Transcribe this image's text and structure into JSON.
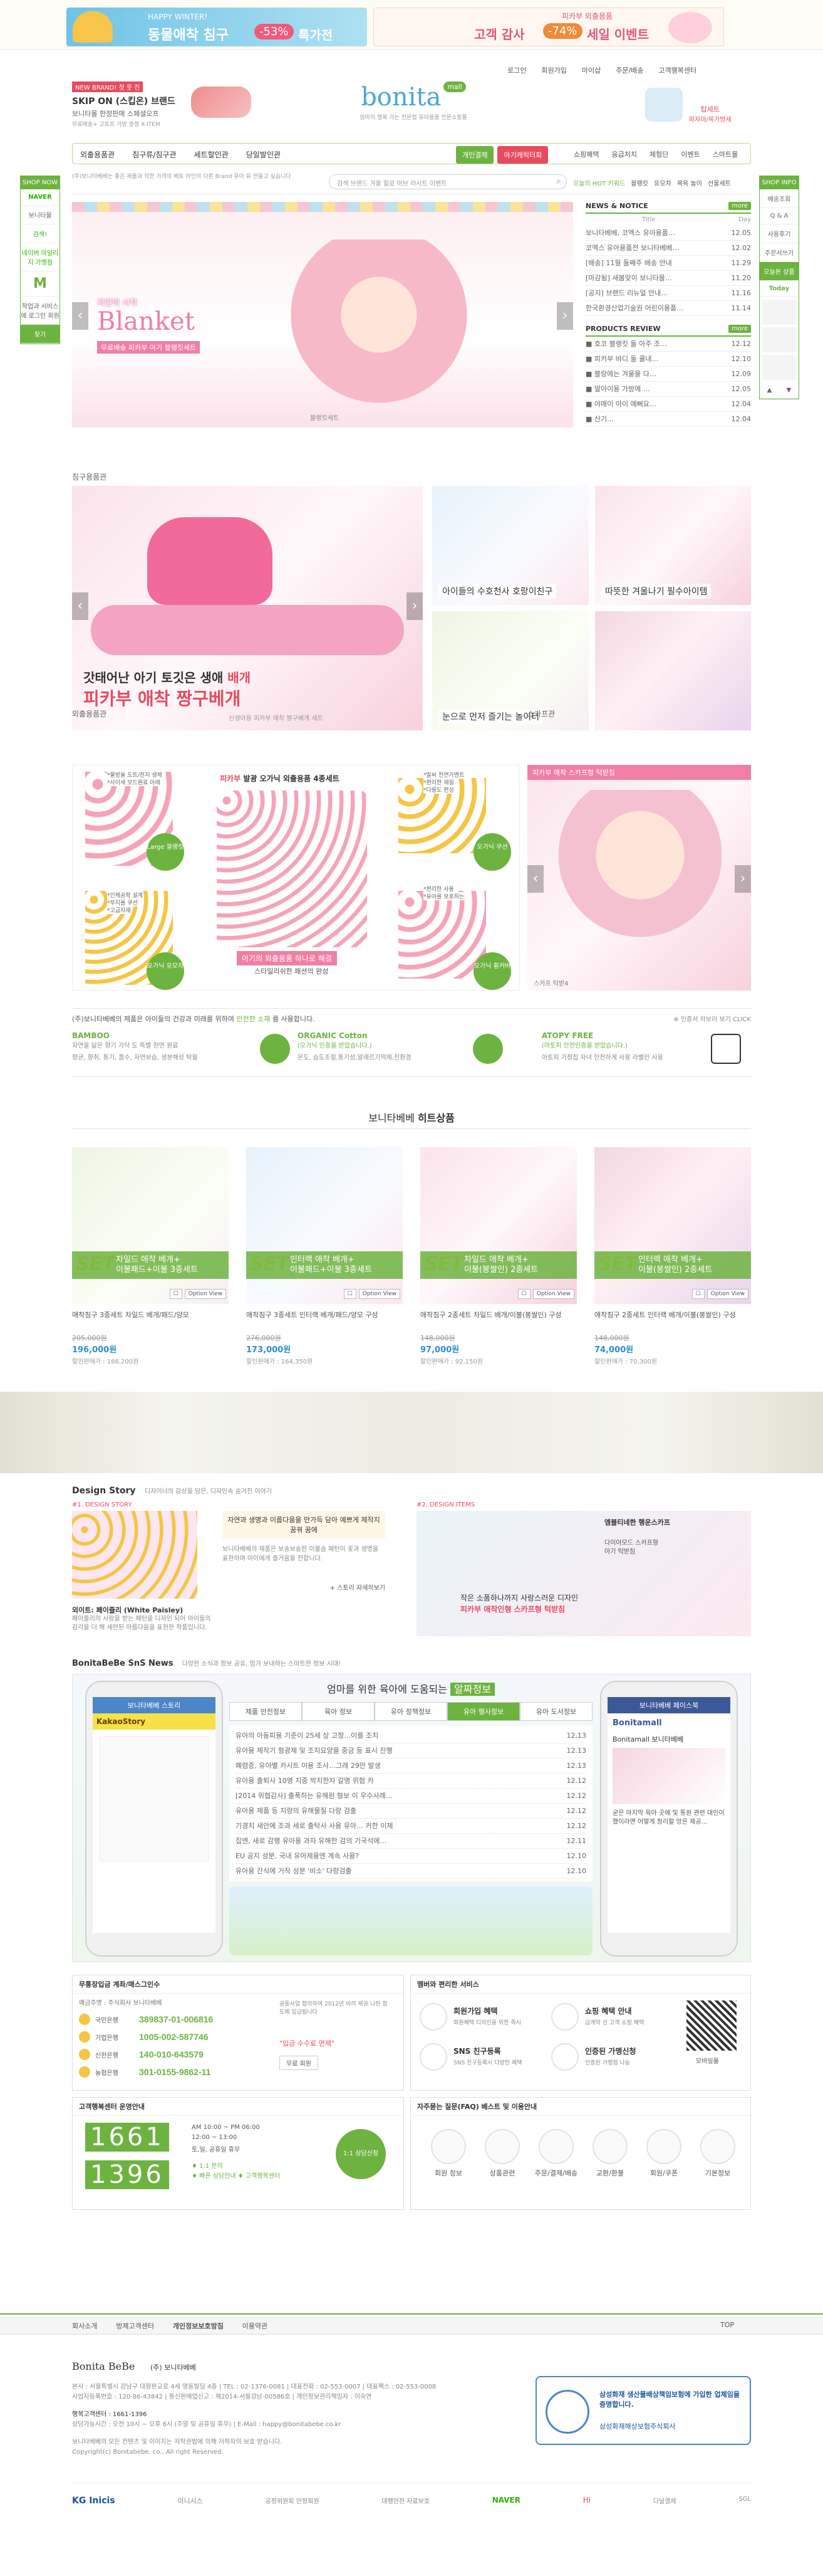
{
  "top_banner": {
    "left_sub": "HAPPY WINTER!",
    "left_title": "동물애착 침구",
    "left_badge": "-53%",
    "left_tail": "특가전",
    "right_sub": "피카부 외출용품",
    "right_title": "고객 감사",
    "right_badge": "-74%",
    "right_tail": "세일 이벤트"
  },
  "util_menu": [
    "로그인",
    "회원가입",
    "마이샵",
    "주문/배송",
    "고객행복센터"
  ],
  "header": {
    "new_brand_tag": "NEW BRAND! 첫 웃 진",
    "promo_title": "SKIP ON (스킵온) 브랜드",
    "promo_sub": "보니타몰 한정판매 스페셜오프",
    "promo_sub2": "무료배송+ 고토트 가방 증정 X-ITEM",
    "logo": "bonita",
    "logo_badge": "mall",
    "logo_tagline": "엄마의 행복 가는 전문점 유아용품 전문쇼핑몰",
    "right_promo1": "탑세트",
    "right_promo2": "파자마/목가방세"
  },
  "gnb": {
    "left": [
      "외출용품관",
      "침구류/침구관",
      "세트할인관",
      "당일발인관"
    ],
    "right_tab1": "개인결제",
    "right_tab2": "아기캐릭터회",
    "right_menu": [
      "쇼핑혜택",
      "응급처치",
      "체험단",
      "이벤트",
      "스마트몰"
    ]
  },
  "side_left": {
    "top_label": "SHOP NOW",
    "naver": "NAVER",
    "naver_sub": "보니타몰",
    "naver_btn": "검색!",
    "naver_desc": "네이버 마일리지 가맹점",
    "m_label": "M",
    "m_desc": "작업과 서비스에 로그인 회원",
    "m_btn": "찾기"
  },
  "notice_bar": {
    "text": "(주)보니타베베는 좋은 제품과 착한 가격의 베토 라인의 다른 Brand 유아 유 만들고 싶습니다",
    "search_placeholder": "검색 브랜드 겨울 할로 어브 라시트 이벤트",
    "hot_label": "오늘의 HOT 키워드",
    "hot_keywords": [
      "블랭킷",
      "유모차",
      "목욕 놀이",
      "선물세트"
    ]
  },
  "hero": {
    "small": "자연의 시작",
    "title": "Blanket",
    "caption": "무료배송 피카부 아기 블랭킷세트",
    "counter": "블랭킷세트"
  },
  "news": {
    "title": "NEWS & NOTICE",
    "more": "more",
    "col_title": "Title",
    "col_day": "Day",
    "items": [
      {
        "t": "보니타베베, 코엑스 유아용품…",
        "d": "12.05"
      },
      {
        "t": "코엑스 유아용품전 보니타베베…",
        "d": "12.02"
      },
      {
        "t": "[배송] 11월 둘째주 배송 안내",
        "d": "11.29"
      },
      {
        "t": "[마감됨] 새봄맞이 보니타몰…",
        "d": "11.20"
      },
      {
        "t": "[공지] 브랜드 리뉴얼 안내…",
        "d": "11.16"
      },
      {
        "t": "한국환경산업기술원 어린이용품…",
        "d": "11.14"
      }
    ],
    "review_title": "PRODUCTS REVIEW",
    "reviews": [
      {
        "t": "■ 호코 블랭킷 돌 아주 조…",
        "d": "12.12"
      },
      {
        "t": "■ 피카부 바디 돌 쿨내…",
        "d": "12.10"
      },
      {
        "t": "■ 블랑에는 겨울을 다…",
        "d": "12.09"
      },
      {
        "t": "■ 딸아이용 가방에 …",
        "d": "12.05"
      },
      {
        "t": "■ 야매이 아이 예뻐요…",
        "d": "12.04"
      },
      {
        "t": "■ 산기…",
        "d": "12.04"
      }
    ]
  },
  "section_sleep": {
    "title": "침구용품관",
    "main_line1": "갓태어난 아기 토깃은 생애",
    "main_line1b": "배개",
    "main_line2": "피카부 애착 짱구베개",
    "main_caption": "신생아용 피카부 애착 짱구베개 세트",
    "thumbs": [
      "아이들의 수호천사 호랑이친구",
      "따뜻한 겨울나기 필수아이템",
      "눈으로 먼저 즐기는 놀이터",
      ""
    ]
  },
  "section_outdoor": {
    "title": "외출용품관",
    "labels": [
      "*물방울 도트/천지 생체",
      "*사이세 모드원료 아래",
      "*인체공학 설계",
      "*무지를 쿠션",
      "*고급자재"
    ],
    "center_head": "피카부",
    "center_head2": "발광 오가닉 외출용품 4종세트",
    "center_sub1": "아기의 외출용품 하나로 해결",
    "center_sub2": "스타일리쉬한 패션의 완성",
    "right_labels": [
      "*말씨 천연가멘트",
      "*편리한 재질",
      "*다용도 편성",
      "*편리한 사용",
      "*유아를 보호하는"
    ],
    "cta_left_top": "Large 블랭킷",
    "cta_left_bot": "오가닉 유모차",
    "cta_right_top": "오가닉 쿠션",
    "cta_right_bot": "오가닉 휠커버",
    "scarf_title": "스카프관",
    "scarf_head": "피카부 애착 스카프형 턱받침",
    "scarf_counter": "스카프 턱받4"
  },
  "eco": {
    "intro": "(주)보니타베베의 제품은 아이들의 건강과 미래를 위하여",
    "intro_accent": "안전한 소재",
    "intro_tail": "를 사용합니다.",
    "cert_label": "※ 인증서 차보러 보기 CLICK",
    "items": [
      {
        "title": "BAMBOO",
        "desc": "자연을 닮은 향기 가닥 도 특별 천연 원료",
        "note": "향균, 향취, 통기, 흡수, 자연보습, 생분해성 탁월"
      },
      {
        "title": "ORGANIC Cotton",
        "desc": "(오가닉 인증을 받았습니다.)",
        "note": "온도, 습도조절,통기성,알레르기억제,친환경"
      },
      {
        "title": "ATOPY FREE",
        "desc": "(아토피 안전인증을 받았습니다.)",
        "note": "아토피 가정집 자녀 안전하게 사용 라벨인 사용"
      }
    ]
  },
  "hits": {
    "title_prefix": "보니타베베",
    "title": "히트상품",
    "products": [
      {
        "banner1": "차일드 애착 베개+",
        "banner2": "이불패드+이불 3종세트",
        "name": "애착침구 3종세트 차일드 베개/패드/양모",
        "old": "205,000원",
        "price": "196,000원",
        "coupon": "할인판매가 : 186,200원"
      },
      {
        "banner1": "인터랙 애착 베개+",
        "banner2": "이불패드+이불 3종세트",
        "name": "애착침구 3종세트 인터랙 베개/패드/양모 구성",
        "old": "276,000원",
        "price": "173,000원",
        "coupon": "할인판매가 : 164,350원"
      },
      {
        "banner1": "차일드 애착 베개+",
        "banner2": "이불(봉쌀인) 2종세트",
        "name": "애착침구 2종세트 차일드 베개/이불(봉쌀인) 구성",
        "old": "148,000원",
        "price": "97,000원",
        "coupon": "할인판매가 : 92,150원"
      },
      {
        "banner1": "인터랙 애착 베개+",
        "banner2": "이불(봉쌀인) 2종세트",
        "name": "애착침구 2종세트 인터랙 베개/이불(봉쌀인) 구성",
        "old": "148,000원",
        "price": "74,000원",
        "coupon": "할인판매가 : 70,300원"
      }
    ],
    "buy_btn": "Option View",
    "set_label": "SET"
  },
  "design_story": {
    "title": "Design Story",
    "sub": "디자이너의 감성을 담은, 디자인속 숨겨진 이야기",
    "left_label": "#1. DESIGN STORY",
    "left_desc_title": "자연과 생명과 이름다움을 만가득 담아 예쁘게 제작지 꿈꿔 꿈에",
    "left_caption": "보니타베베의 제품은 보송보송한 이불솜 패턴이 꽃과 생명을 표현하며 아이에게 즐거움을 전합니다.",
    "paisley_title": "외이트: 페이즐리 (White Paisley)",
    "paisley_desc": "페이즐리의 사랑을 받는 패턴을 디자인 되어 아이들의 감각을 더 해 세련된 아름다움을 표현한 작품입니다.",
    "story_link": "+ 스토리 자세히보기",
    "right_label": "#2. DESIGN ITEMS",
    "right_head": "엠블티네한 행운스카프",
    "right_item1": "다이아모드 스카프형",
    "right_item2": "아기 턱받침",
    "right_caption": "작은 소품하나까지 사랑스러운 디자인",
    "right_caption2": "피카부 애착인형 스카프형 턱받침"
  },
  "sns": {
    "title": "BonitaBeBe SnS News",
    "sub": "다양한 소식과 정보 공유, 엄가 보내하는 스마트한 정보 시대!",
    "left_phone_title": "보니타베베 스토리",
    "left_phone_head": "KakaoStory",
    "right_phone_title": "보니타베베 페이스북",
    "center_heading": "엄마를 위한 육아에 도움되는",
    "center_heading_accent": "알짜정보",
    "tabs": [
      "제품 안전정보",
      "육아 정보",
      "유아 정책정보",
      "유아 행사정보",
      "유아 도서정보"
    ],
    "list": [
      {
        "t": "유아의 아동피용 기준이 25세 상 고정…이를 조치",
        "d": "12.13"
      },
      {
        "t": "유아용 제작기 형광제 및 조치요양을 중금 등 표시 진행",
        "d": "12.13"
      },
      {
        "t": "폐렴증, 유아별 카시트 이용 조사…그래 29만 발생",
        "d": "12.13"
      },
      {
        "t": "유아용 출퇴사 10명 지중 박치한자 갈명 위험 카",
        "d": "12.12"
      },
      {
        "t": "[2014 위협감사] 출폭하는 유해원 형보 이 우수사례…",
        "d": "12.12"
      },
      {
        "t": "유아용 제품 등 지량의 유해물질 다량 검출",
        "d": "12.12"
      },
      {
        "t": "기경치 새안에 조과 세로 출탁사 사용 유아… 커한 이제",
        "d": "12.12"
      },
      {
        "t": "집엔, 새로 감행 유아용 과자 유해한 검의 기국석에…",
        "d": "12.11"
      },
      {
        "t": "EU 공지 성분, 국내 유아제용엔 계속 사용?",
        "d": "12.10"
      },
      {
        "t": "유아용 간식에 거작 성분 '비소' 다량검출",
        "d": "12.10"
      }
    ],
    "fb_brand": "Bonitamall",
    "fb_post_name": "Bonitamall 보니타베베",
    "fb_desc": "굳은 마지막 육아 곳에 및 통원 관련 대인이 했이라면 어떻게 정리할 앙은 제공…"
  },
  "cs": {
    "title": "무통장입금 계좌/매스그인수",
    "owner_label": "예금주명 : 주식회사 보니타베베",
    "banks": [
      {
        "bank": "국민은행",
        "no": "389837-01-006816"
      },
      {
        "bank": "기업은행",
        "no": "1005-002-587746"
      },
      {
        "bank": "신한은행",
        "no": "140-010-643579"
      },
      {
        "bank": "농협은행",
        "no": "301-0155-9862-11"
      }
    ],
    "side_desc": "공동사업 합의하여 2012년 비리 제공 나란 정도에 입금됩니다",
    "side_btn": "\"입금 수수료 면제\"",
    "side_link": "무료 회원"
  },
  "member_service": {
    "title": "멤버와 편리한 서비스",
    "items": [
      {
        "title": "회원가입 혜택",
        "desc": "회원혜택 디자인을 위한 즉시"
      },
      {
        "title": "쇼핑 혜택 안내",
        "desc": "금계약 선 고객 쇼핑 혜택"
      },
      {
        "title": "SNS 친구등록",
        "desc": "SNS 친구등록시 다양한 혜택"
      },
      {
        "title": "인증된 가맹신청",
        "desc": "인증된 가맹점 나눔"
      }
    ],
    "qr_label": "모바일몰"
  },
  "callcenter": {
    "title": "고객행복센터 운영안내",
    "num1": "1661",
    "num2": "1396",
    "hours": "AM 10:00 ~ PM 06:00",
    "lunch": "12:00 ~ 13:00",
    "holiday": "토,일, 공휴일 휴무",
    "talk1": "♦ 1:1 문의",
    "talk2": "♦ 빠른 상담안내 ♦ 고객행복센터",
    "consult": "1:1 상담신청"
  },
  "faq": {
    "title": "자주묻는 질문(FAQ) 베스트 및 이용안내",
    "items": [
      "회원 정보",
      "상품관련",
      "주문/결제/배송",
      "교환/환불",
      "회원/쿠폰",
      "기본정보"
    ]
  },
  "side_right": {
    "top_label": "SHOP INFO",
    "items": [
      "배송조회",
      "Q & A",
      "사용후기",
      "주문서쓰기",
      "최근 본 상품"
    ],
    "recent": "오늘본 상품",
    "today_btn": "Today",
    "up": "▲",
    "down": "▼"
  },
  "footer": {
    "links": [
      "회사소개",
      "방제고객센터",
      "개인정보보호방침",
      "이용약관"
    ],
    "top": "TOP",
    "company": "(주) 보니타베베",
    "addr1": "본사 : 서울특별시 강남구 대왕판교로 4세 영동빌딩 4층 | TEL : 02-1376-0081 | 대표전화 : 02-553-0007 | 대표팩스 : 02-553-0008",
    "addr2": "사업자등록번호 : 120-86-43842 | 통신판매업신고 : 제2014-서울강남-00586호 | 개인정보관리책임자 : 이숙연",
    "cs_label": "행복고객센터 : 1661-1396",
    "cs_hours": "상담가능시간 : 오전 10시 ~ 오후 6시 (주말 및 공휴일 휴무) | E-Mail : happy@bonitabebe.co.kr",
    "notice1": "보니타베베의 모든 컨텐츠 및 이미지는 저작권법에 의해 저작자의 보호 받습니다.",
    "copyright": "Copyright(c) Bonitabebe. co., All right Reserved.",
    "logo": "Bonita BeBe",
    "badge_title": "삼성화재 생산물배상책임보험에 가입한 업체임을 증명합니다.",
    "badge_sub": "삼성화재해상보험주식회사",
    "logos": [
      "KG Inicis",
      "이니시스",
      "공정위원회 안정회원",
      "대행안전 자료보호",
      "NAVER",
      "Hi",
      "다날결제",
      "SGL"
    ]
  }
}
